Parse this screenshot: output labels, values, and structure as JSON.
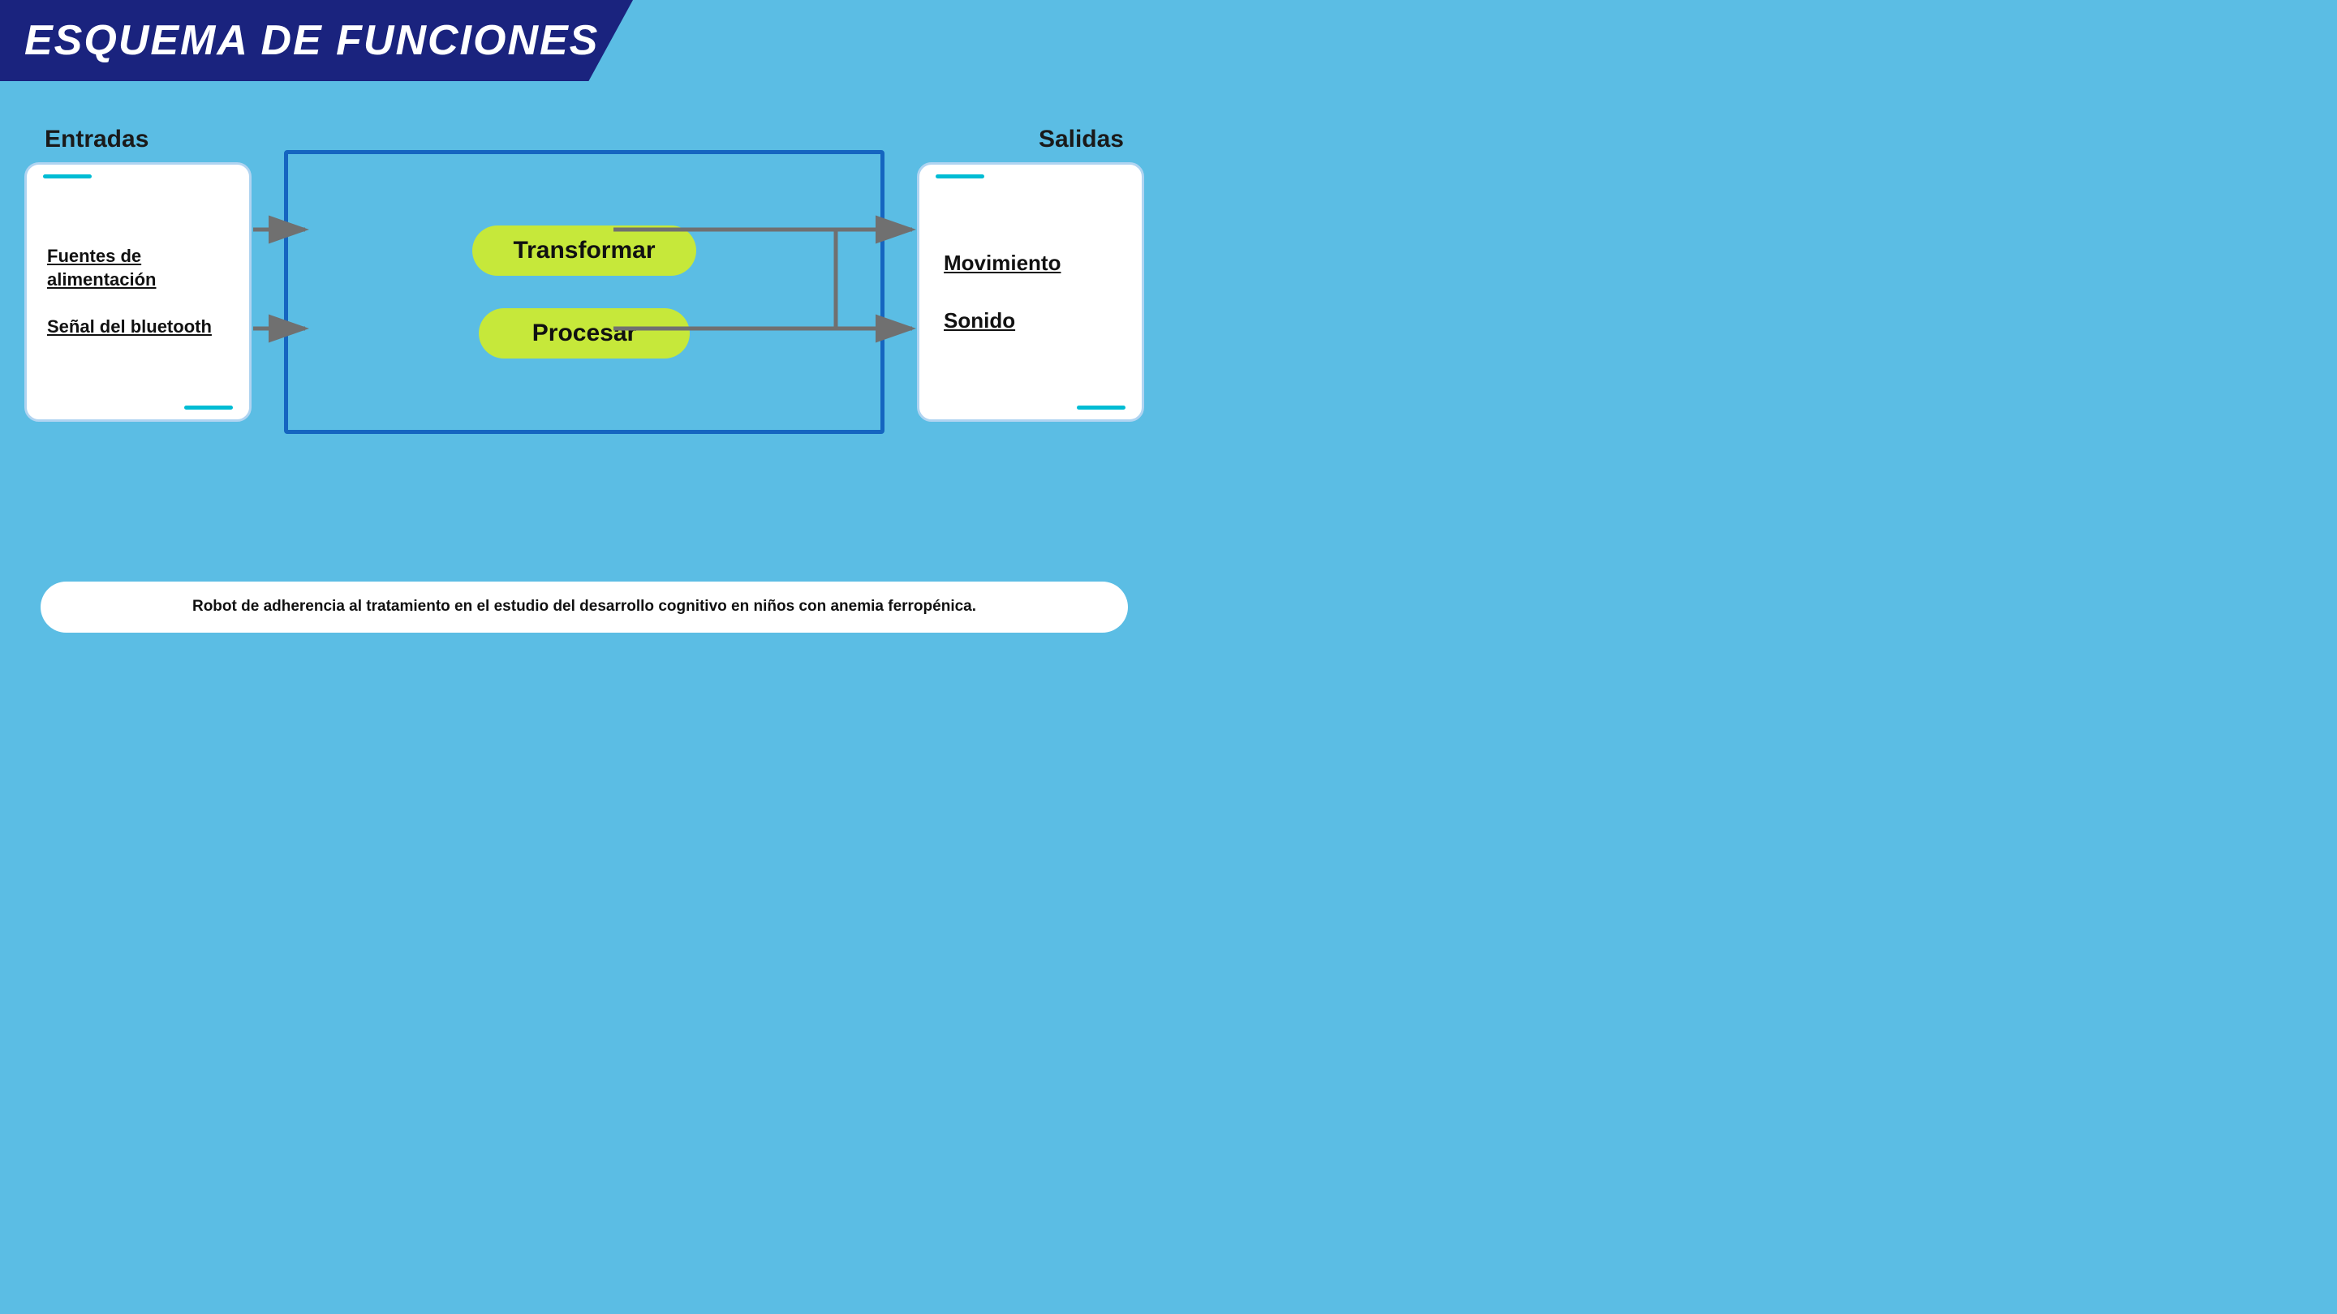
{
  "header": {
    "title": "ESQUEMA DE FUNCIONES"
  },
  "sections": {
    "entradas_label": "Entradas",
    "salidas_label": "Salidas"
  },
  "inputs": {
    "item1": "Fuentes de alimentación",
    "item2": "Señal del bluetooth"
  },
  "outputs": {
    "item1": "Movimiento",
    "item2": "Sonido"
  },
  "functions": {
    "func1": "Transformar",
    "func2": "Procesar"
  },
  "caption": {
    "text": "Robot de adherencia al tratamiento en el estudio del desarrollo cognitivo en niños con anemia ferropénica."
  },
  "colors": {
    "header_bg": "#1a237e",
    "page_bg": "#5bbde4",
    "pill_bg": "#c6e83a",
    "process_border": "#1565c0",
    "accent_teal": "#00bcd4",
    "white": "#ffffff",
    "arrow_gray": "#707070"
  }
}
